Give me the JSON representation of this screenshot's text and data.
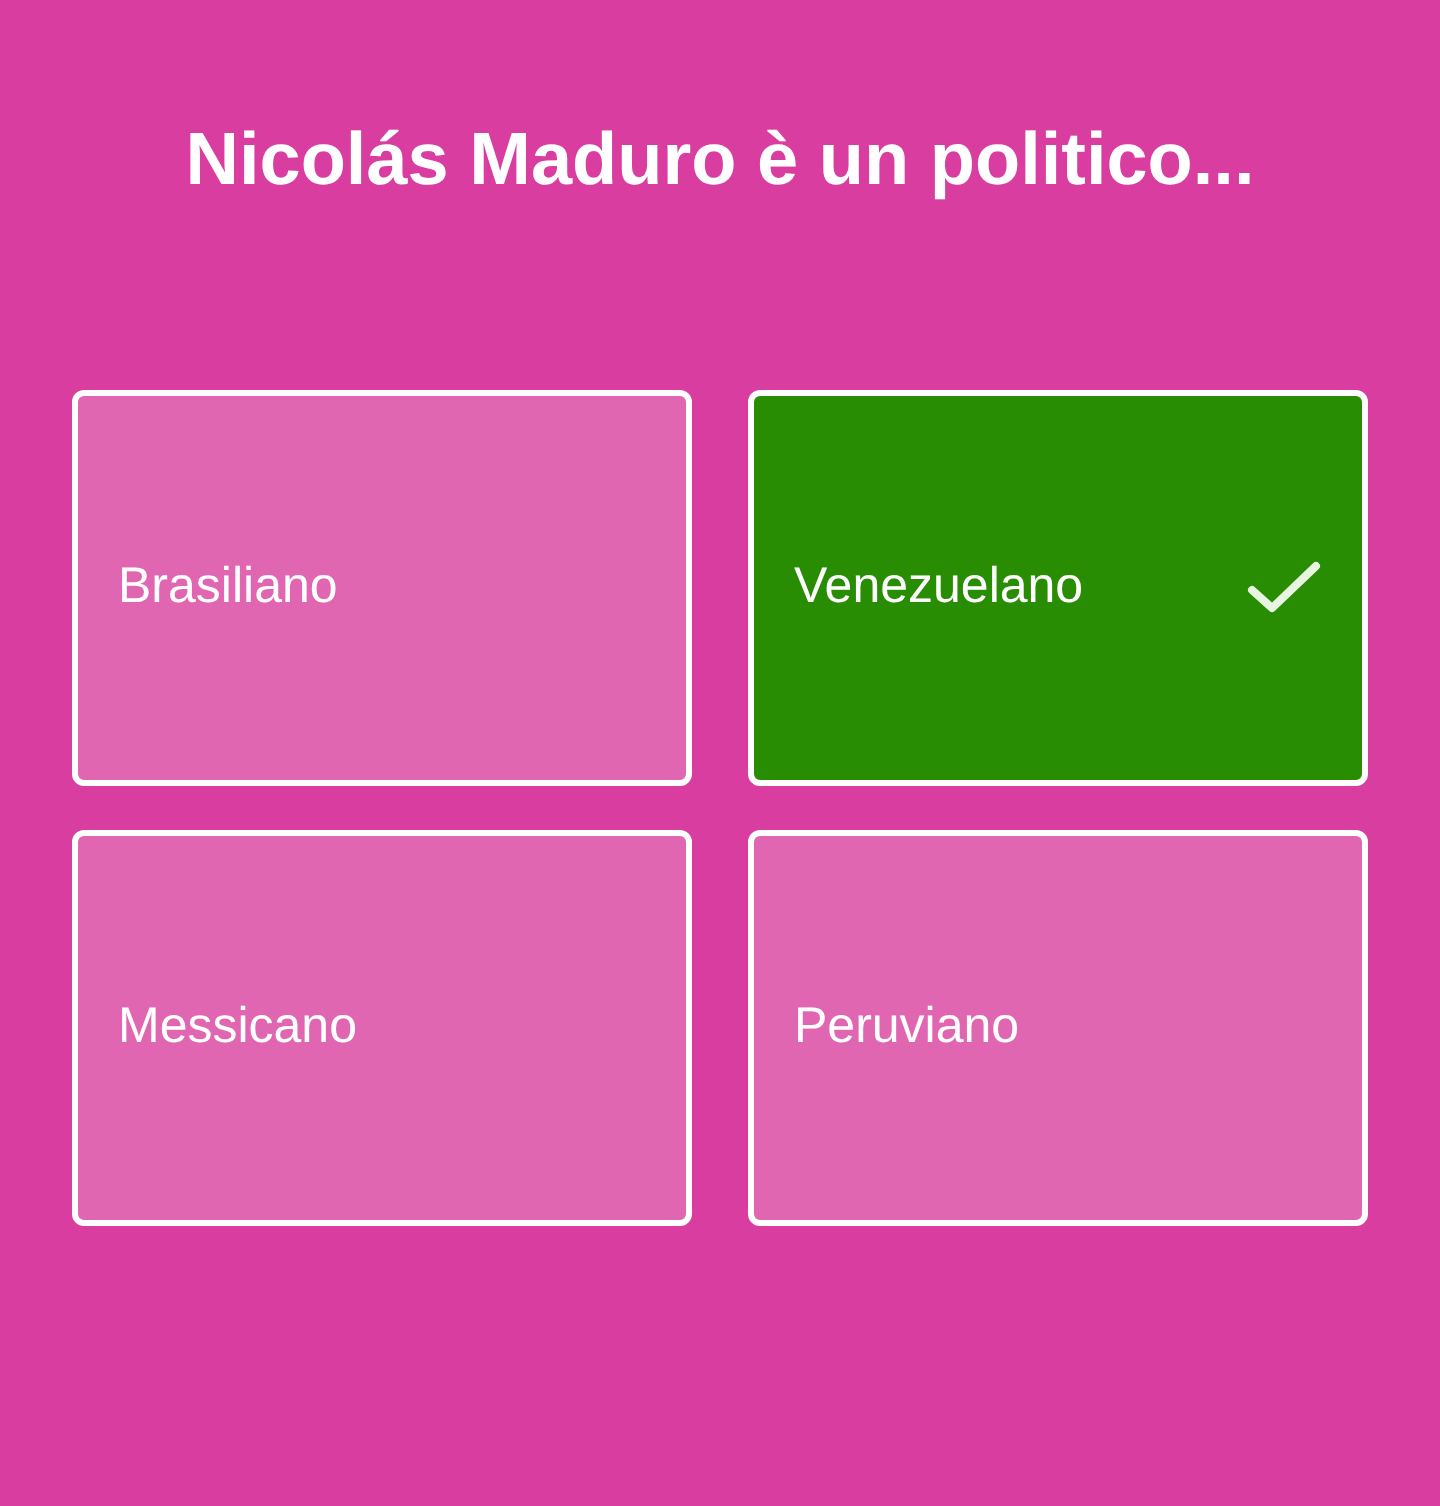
{
  "question": "Nicolás Maduro è un politico...",
  "answers": [
    {
      "label": "Brasiliano",
      "selected": false
    },
    {
      "label": "Venezuelano",
      "selected": true
    },
    {
      "label": "Messicano",
      "selected": false
    },
    {
      "label": "Peruviano",
      "selected": false
    }
  ]
}
